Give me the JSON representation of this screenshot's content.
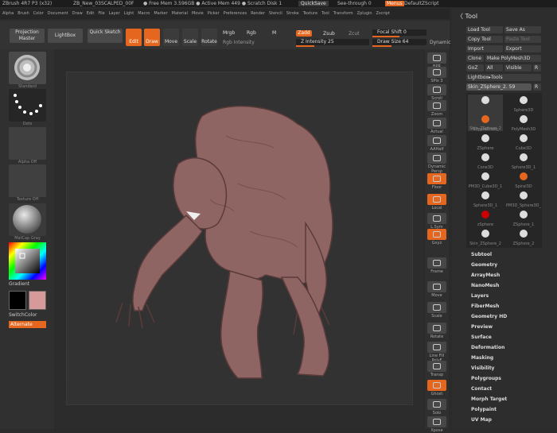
{
  "title_bar": {
    "app": "ZBrush 4R7 P3 (x32)",
    "doc": "ZB_New_03SCALPED_00F",
    "mem": "● Free Mem 3.596GB ● Active Mem 449 ● Scratch Disk 1",
    "quicksave": "QuickSave",
    "seethrough": "See-through 0",
    "menus": "Menus",
    "script": "DefaultZScript"
  },
  "menu_items": [
    "Alpha",
    "Brush",
    "Color",
    "Document",
    "Draw",
    "Edit",
    "File",
    "Layer",
    "Light",
    "Macro",
    "Marker",
    "Material",
    "Movie",
    "Picker",
    "Preferences",
    "Render",
    "Stencil",
    "Stroke",
    "Texture",
    "Tool",
    "Transform",
    "Zplugin",
    "Zscript"
  ],
  "toolbar": {
    "projection_master": "Projection Master",
    "lightbox": "LightBox",
    "quick_sketch": "Quick Sketch",
    "edit": "Edit",
    "draw": "Draw",
    "move": "Move",
    "scale": "Scale",
    "rotate": "Rotate",
    "mrgb": "Mrgb",
    "rgb": "Rgb",
    "m": "M",
    "rgb_intensity": "Rgb Intensity",
    "zadd": "Zadd",
    "zsub": "Zsub",
    "zcut": "Zcut",
    "z_intensity": "Z Intensity 25",
    "focal_shift": "Focal Shift 0",
    "draw_size": "Draw Size 64",
    "dynamic": "Dynamic"
  },
  "left_shelf": {
    "standard": "Standard",
    "dots": "Dots",
    "alpha_off": "Alpha Off",
    "texture_off": "Texture Off",
    "matcap": "MatCap Gray",
    "gradient": "Gradient",
    "switch_color": "SwitchColor",
    "alternate": "Alternate",
    "colors": {
      "primary": "#000000",
      "secondary": "#d79a9a"
    }
  },
  "right_shelf": [
    "BPR",
    "SPix 3",
    "Scroll",
    "Zoom",
    "Actual",
    "AAHalf",
    "Dynamic Persp",
    "Floor",
    "Local",
    "L.Sym",
    "Gxyz",
    "Frame",
    "Move",
    "Scale",
    "Rotate",
    "Line Fill PolyF",
    "Transp",
    "Ghost",
    "Solo",
    "Xpose"
  ],
  "tool_panel": {
    "title": "Tool",
    "load_tool": "Load Tool",
    "save_as": "Save As",
    "copy_tool": "Copy Tool",
    "paste_tool": "Paste Tool",
    "import": "Import",
    "export": "Export",
    "clone": "Clone",
    "make_polymesh": "Make PolyMesh3D",
    "goz": "GoZ",
    "all": "All",
    "visible": "Visible",
    "r": "R",
    "lightbox_tools": "Lightbox▸Tools",
    "current_tool": "Skin_ZSphere_2. 59",
    "tools": [
      "Skin_ZSphere_2",
      "Sphere3D",
      "SimpleBrush",
      "PolyMesh3D",
      "ZSphere",
      "Cube3D",
      "Cone3D",
      "Sphere3D_1",
      "PM3D_Cube3D_1",
      "Spiral3D",
      "Sphere3D_1",
      "PM3D_Sphere3D_1",
      "zSphere",
      "ZSphere_1",
      "Skin_ZSphere_2",
      "ZSphere_2"
    ],
    "subpalettes": [
      "Subtool",
      "Geometry",
      "ArrayMesh",
      "NanoMesh",
      "Layers",
      "FiberMesh",
      "Geometry HD",
      "Preview",
      "Surface",
      "Deformation",
      "Masking",
      "Visibility",
      "Polygroups",
      "Contact",
      "Morph Target",
      "Polypaint",
      "UV Map"
    ]
  },
  "colors": {
    "accent": "#e5661e",
    "model": "#8f6564"
  }
}
